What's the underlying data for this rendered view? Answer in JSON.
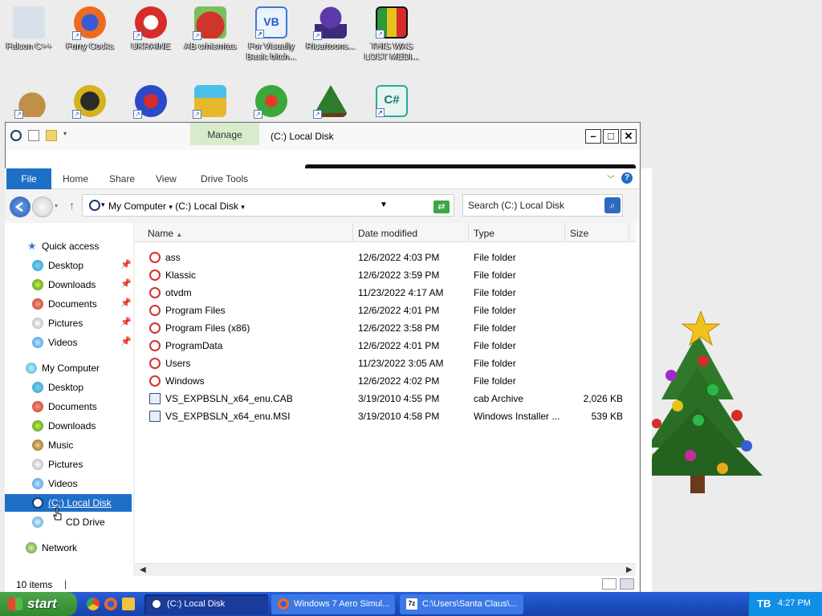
{
  "desktop_icons": [
    {
      "label": "Falcon C++",
      "icon": "falcon-recycle-icon",
      "color": "#cfd8e6"
    },
    {
      "label": "Furry Cocks",
      "icon": "firefox-icon",
      "color": "#f06a1e"
    },
    {
      "label": "UKRAINE",
      "icon": "radiation-icon",
      "color": "#d62c2c"
    },
    {
      "label": "AB crhismtas",
      "icon": "angry-bird-icon",
      "color": "#c8302c"
    },
    {
      "label": "For Visually Basic bitch...",
      "icon": "vb-icon",
      "color": "#4a8fe0"
    },
    {
      "label": "Ricartoons...",
      "icon": "ninja-icon",
      "color": "#4a2a8a"
    },
    {
      "label": "THIS WAS LOST MEDI...",
      "icon": "colorblock-icon",
      "color": "#2a9a3a"
    }
  ],
  "desktop_icons_row2": [
    {
      "icon": "money-bag-icon",
      "color": "#b8863a"
    },
    {
      "icon": "cpp-icon",
      "color": "#d6b31c"
    },
    {
      "icon": "number-two-icon",
      "color": "#2a4ac8"
    },
    {
      "icon": "folder-app-icon",
      "color": "#e8b82c"
    },
    {
      "icon": "goblin-icon",
      "color": "#3aa83a"
    },
    {
      "icon": "small-tree-icon",
      "color": "#2e7a2e"
    },
    {
      "icon": "csharp-icon",
      "color": "#29a89a"
    }
  ],
  "window": {
    "title": "(C:) Local Disk",
    "manage_tab": "Manage",
    "minimize": "–",
    "maximize": "□",
    "close": "✕"
  },
  "ribbon": {
    "tabs": [
      "File",
      "Home",
      "Share",
      "View",
      "Drive Tools"
    ],
    "help": "?"
  },
  "address": {
    "root": "My Computer",
    "current": "(C:) Local Disk",
    "separator": "▾"
  },
  "search": {
    "placeholder": "Search (C:) Local Disk"
  },
  "nav": {
    "quick_access": "Quick access",
    "quick_items": [
      "Desktop",
      "Downloads",
      "Documents",
      "Pictures",
      "Videos"
    ],
    "my_computer": "My Computer",
    "computer_items": [
      "Desktop",
      "Documents",
      "Downloads",
      "Music",
      "Pictures",
      "Videos",
      "(C:) Local Disk",
      "CD Drive"
    ],
    "network": "Network"
  },
  "columns": {
    "name": "Name",
    "date": "Date modified",
    "type": "Type",
    "size": "Size"
  },
  "files": [
    {
      "name": "ass",
      "date": "12/6/2022 4:03 PM",
      "type": "File folder",
      "size": ""
    },
    {
      "name": "Klassic",
      "date": "12/6/2022 3:59 PM",
      "type": "File folder",
      "size": ""
    },
    {
      "name": "otvdm",
      "date": "11/23/2022 4:17 AM",
      "type": "File folder",
      "size": ""
    },
    {
      "name": "Program Files",
      "date": "12/6/2022 4:01 PM",
      "type": "File folder",
      "size": ""
    },
    {
      "name": "Program Files (x86)",
      "date": "12/6/2022 3:58 PM",
      "type": "File folder",
      "size": ""
    },
    {
      "name": "ProgramData",
      "date": "12/6/2022 4:01 PM",
      "type": "File folder",
      "size": ""
    },
    {
      "name": "Users",
      "date": "11/23/2022 3:05 AM",
      "type": "File folder",
      "size": ""
    },
    {
      "name": "Windows",
      "date": "12/6/2022 4:02 PM",
      "type": "File folder",
      "size": ""
    },
    {
      "name": "VS_EXPBSLN_x64_enu.CAB",
      "date": "3/19/2010 4:55 PM",
      "type": "cab Archive",
      "size": "2,026 KB"
    },
    {
      "name": "VS_EXPBSLN_x64_enu.MSI",
      "date": "3/19/2010 4:58 PM",
      "type": "Windows Installer ...",
      "size": "539 KB"
    }
  ],
  "status": {
    "items": "10 items"
  },
  "taskbar": {
    "start": "start",
    "buttons": [
      "(C:) Local Disk",
      "Windows 7 Aero Simul...",
      "C:\\Users\\Santa Claus\\..."
    ],
    "clock": "4:27 PM"
  },
  "colors": {
    "accent": "#1e6fc8",
    "manage": "#d7eccb",
    "taskbar": "#1d4fc2",
    "start": "#3c9a38"
  }
}
